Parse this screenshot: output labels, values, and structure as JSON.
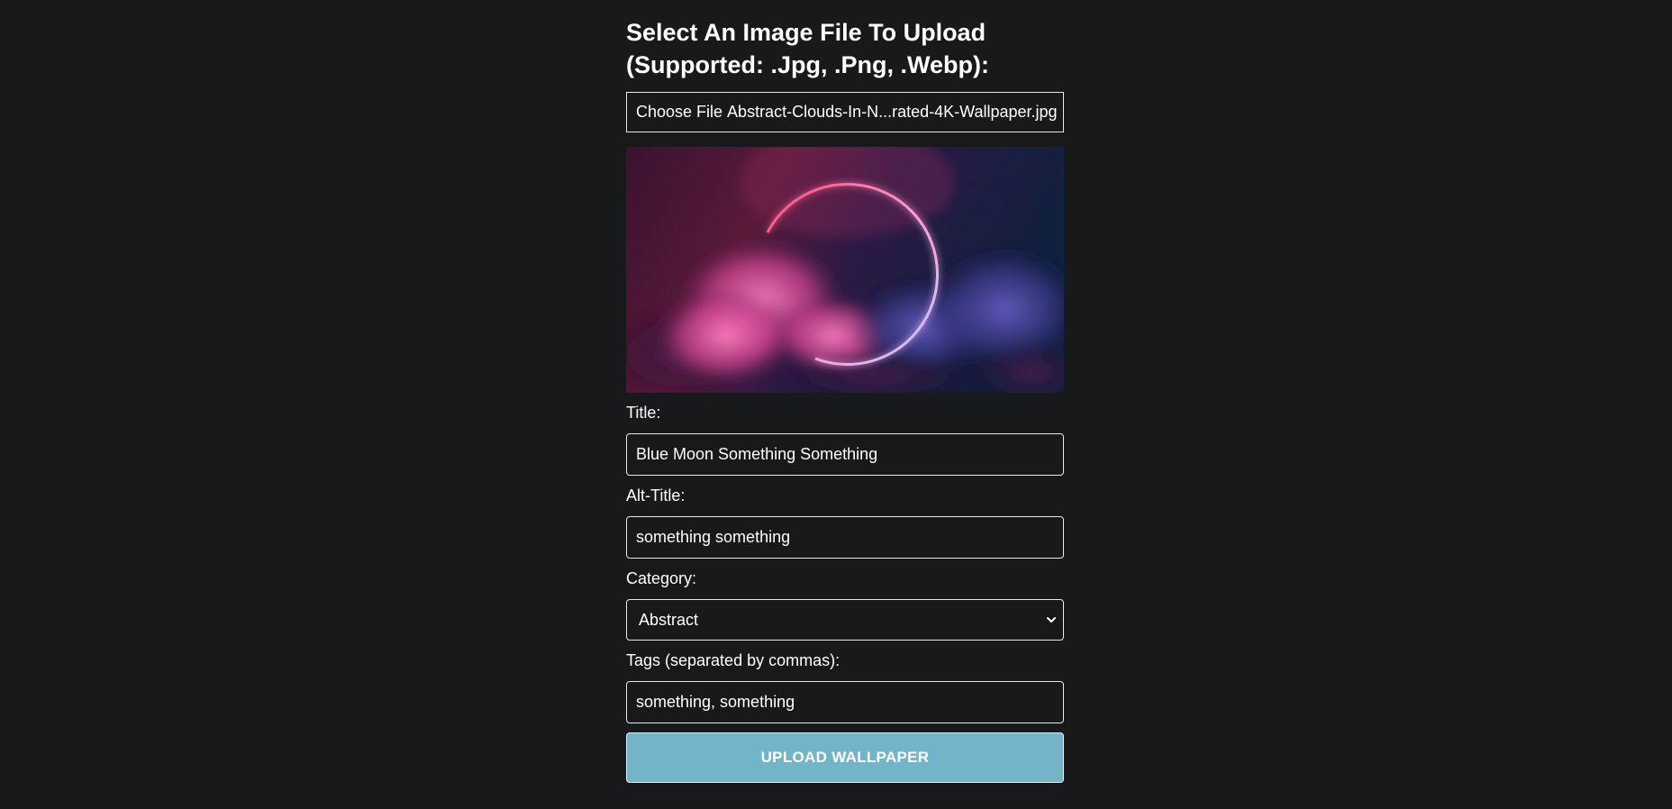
{
  "upload": {
    "heading_line1": "Select An Image File To Upload",
    "heading_line2": "(Supported: .Jpg, .Png, .Webp):",
    "choose_file_label": "Choose File",
    "file_name": "Abstract-Clouds-In-N...rated-4K-Wallpaper.jpg"
  },
  "fields": {
    "title_label": "Title:",
    "title_value": "Blue Moon Something Something",
    "alt_title_label": "Alt-Title:",
    "alt_title_value": "something something",
    "category_label": "Category:",
    "category_value": "Abstract",
    "tags_label": "Tags (separated by commas):",
    "tags_value": "something, something"
  },
  "actions": {
    "upload_label": "UPLOAD WALLPAPER"
  },
  "colors": {
    "background": "#18191b",
    "button": "#73b4c9",
    "border": "#e8e8e8"
  }
}
